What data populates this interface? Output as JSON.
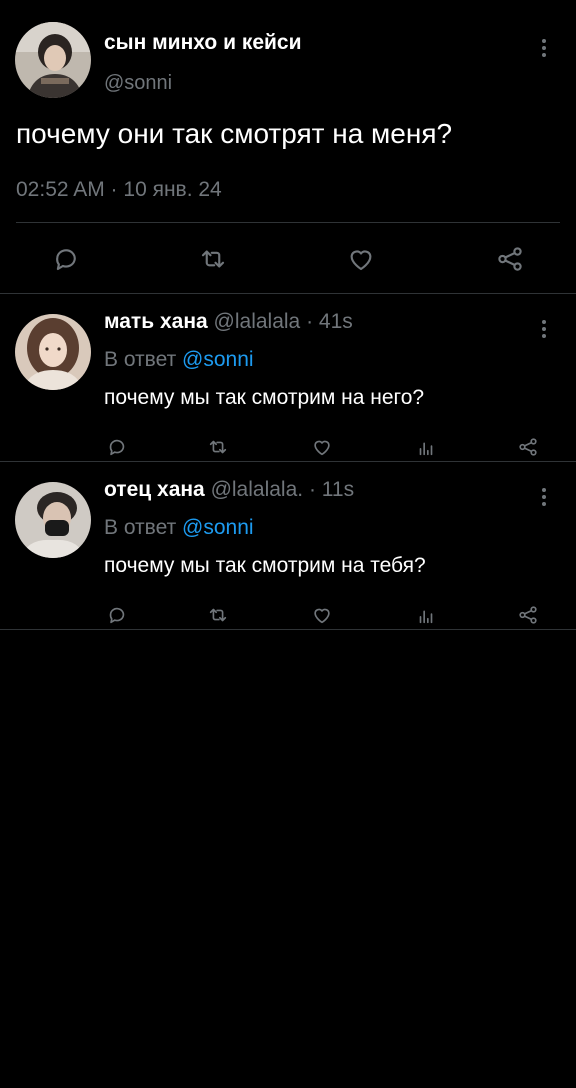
{
  "main_tweet": {
    "display_name": "сын минхо и кейси",
    "handle": "@sonni",
    "text": "почему они так смотрят на меня?",
    "timestamp": "02:52 AM · 10 янв. 24",
    "avatar_icon": "user-avatar-photo"
  },
  "replies": [
    {
      "display_name": "мать хана",
      "handle": "@lalalala",
      "time": "· 41s",
      "reply_prefix": "В ответ",
      "reply_to": "@sonni",
      "text": "почему мы так смотрим на него?"
    },
    {
      "display_name": "отец хана",
      "handle": "@lalalala.",
      "time": "· 11s",
      "reply_prefix": "В ответ",
      "reply_to": "@sonni",
      "text": "почему мы так смотрим на тебя?"
    }
  ],
  "colors": {
    "background": "#000000",
    "text": "#e7e9ea",
    "muted": "#71767b",
    "link": "#1d9bf0",
    "divider": "#2f3336"
  }
}
